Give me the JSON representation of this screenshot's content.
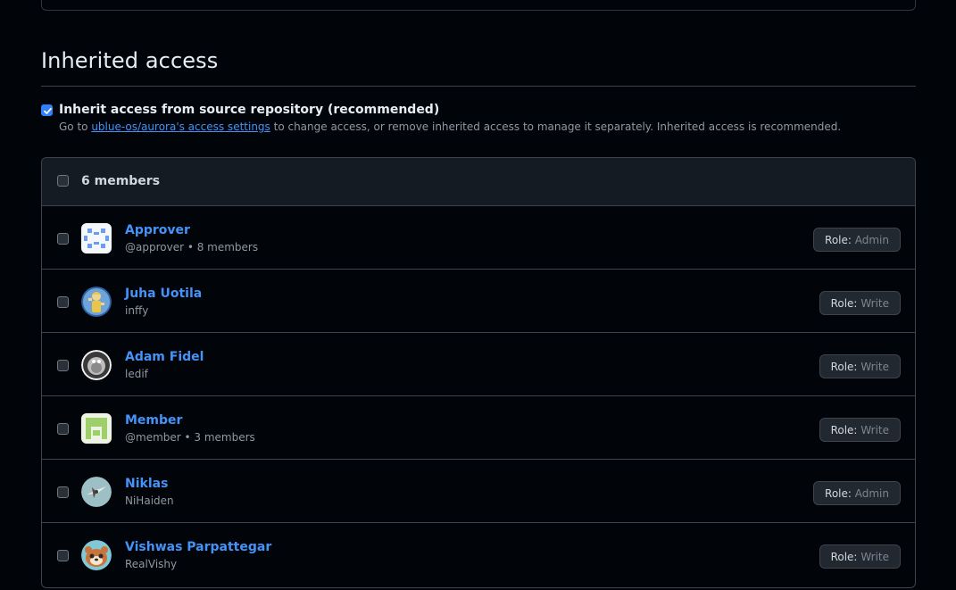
{
  "section": {
    "title": "Inherited access"
  },
  "inherit": {
    "label": "Inherit access from source repository (recommended)",
    "note_prefix": "Go to ",
    "link_text": "ublue-os/aurora's access settings",
    "note_suffix": " to change access, or remove inherited access to manage it separately. Inherited access is recommended.",
    "checked": true
  },
  "members": {
    "count_label": "6 members",
    "role_prefix": "Role:",
    "list": [
      {
        "name": "Approver",
        "sub": "@approver • 8 members",
        "role": "Admin",
        "avatar": "approver-team-icon"
      },
      {
        "name": "Juha Uotila",
        "sub": "inffy",
        "role": "Write",
        "avatar": "juha-avatar"
      },
      {
        "name": "Adam Fidel",
        "sub": "ledif",
        "role": "Write",
        "avatar": "adam-avatar"
      },
      {
        "name": "Member",
        "sub": "@member • 3 members",
        "role": "Write",
        "avatar": "member-team-icon"
      },
      {
        "name": "Niklas",
        "sub": "NiHaiden",
        "role": "Admin",
        "avatar": "niklas-avatar"
      },
      {
        "name": "Vishwas Parpattegar",
        "sub": "RealVishy",
        "role": "Write",
        "avatar": "vishwas-avatar"
      }
    ]
  },
  "colors": {
    "background": "#010409",
    "link": "#4493f8",
    "checkbox_checked": "#2f81f7",
    "border": "#3d444d"
  }
}
